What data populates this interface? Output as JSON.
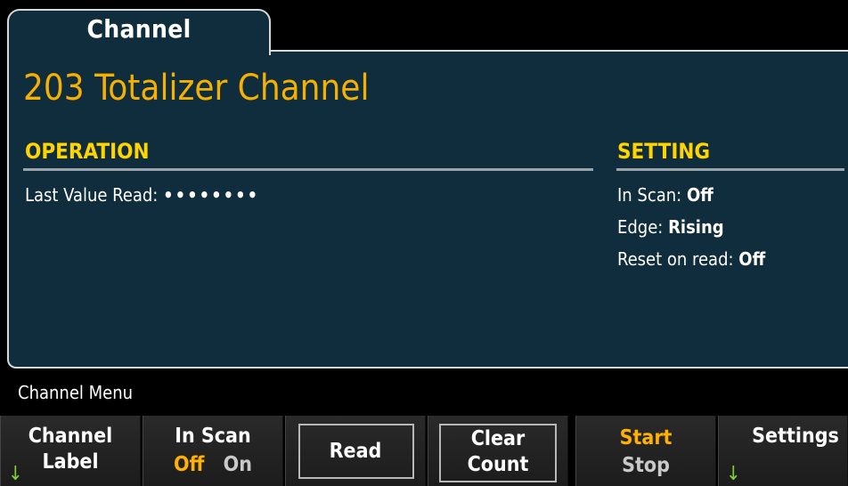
{
  "tab": {
    "label": "Channel"
  },
  "title": "203  Totalizer Channel",
  "operation": {
    "header": "OPERATION",
    "last_value_label": "Last Value Read:",
    "last_value": "••••••••"
  },
  "setting": {
    "header": "SETTING",
    "in_scan_label": "In Scan:",
    "in_scan_value": "Off",
    "edge_label": "Edge:",
    "edge_value": "Rising",
    "reset_label": "Reset on read:",
    "reset_value": "Off"
  },
  "menu": {
    "title": "Channel Menu"
  },
  "softkeys": {
    "channel_label_line1": "Channel",
    "channel_label_line2": "Label",
    "in_scan_title": "In Scan",
    "in_scan_off": "Off",
    "in_scan_on": "On",
    "read": "Read",
    "clear_line1": "Clear",
    "clear_line2": "Count",
    "start": "Start",
    "stop": "Stop",
    "settings": "Settings"
  },
  "icons": {
    "submenu_arrow": "arrow-down-icon"
  },
  "colors": {
    "panel": "#0f2d3c",
    "title": "#f5b000",
    "header": "#ffd400",
    "active": "#ffb000",
    "arrow": "#7fd13a"
  }
}
